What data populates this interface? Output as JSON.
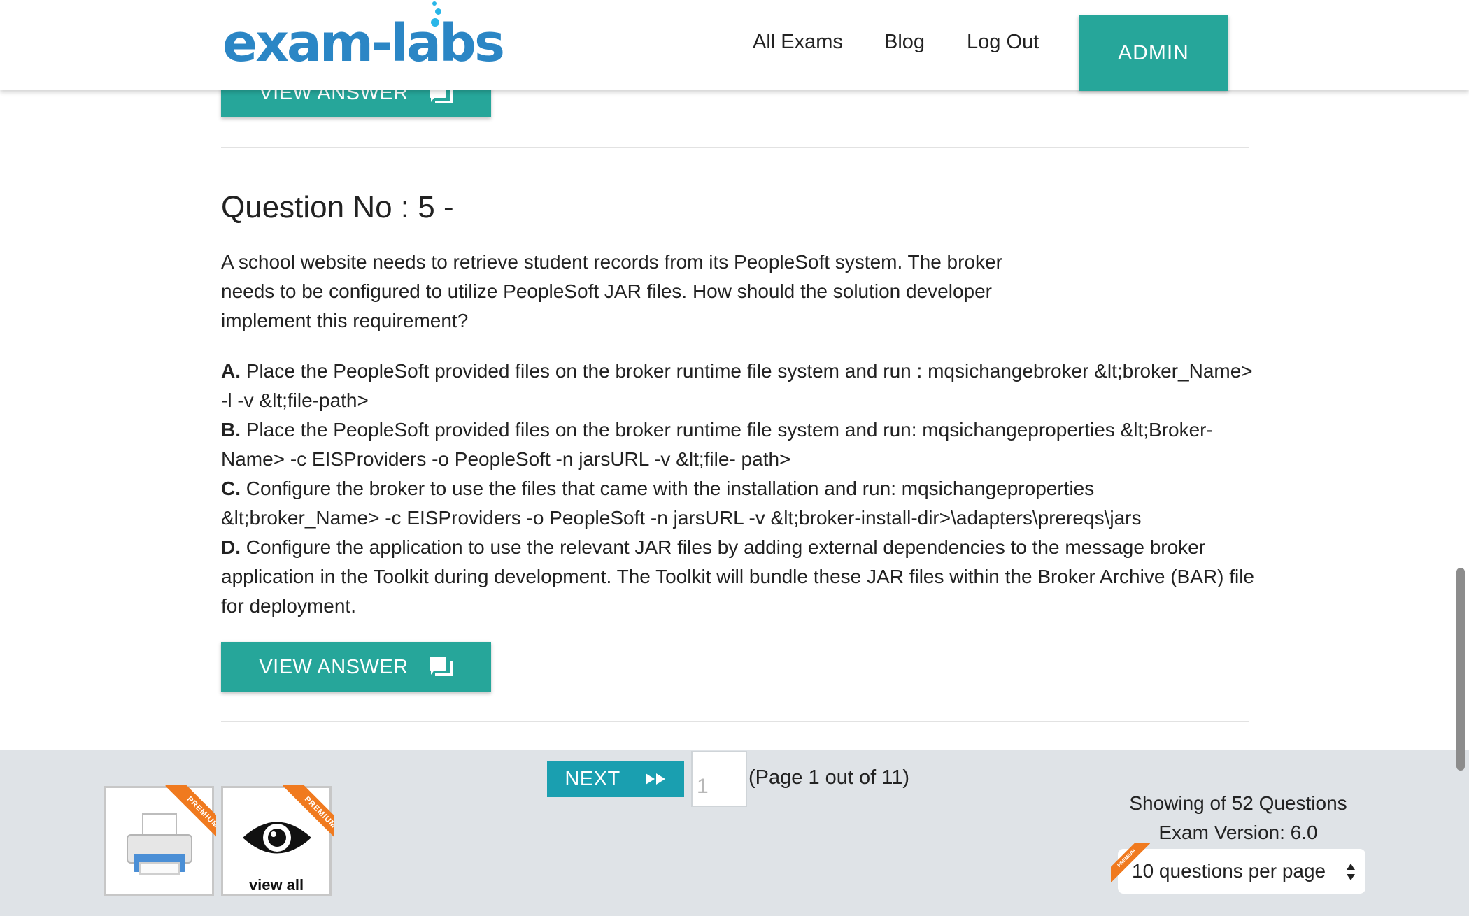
{
  "header": {
    "logo_text": "exam-labs",
    "nav": {
      "all_exams": "All Exams",
      "blog": "Blog",
      "log_out": "Log Out",
      "admin": "ADMIN"
    }
  },
  "question": {
    "prev_view_answer_label": "VIEW ANSWER",
    "title": "Question No : 5 -",
    "text": "A school website needs to retrieve student records from its PeopleSoft system. The broker needs to be configured to utilize PeopleSoft JAR files. How should the solution developer implement this requirement?",
    "options": [
      {
        "letter": "A.",
        "text": "Place the PeopleSoft provided files on the broker runtime file system and run : mqsichangebroker &lt;broker_Name> -l -v &lt;file-path>"
      },
      {
        "letter": "B.",
        "text": "Place the PeopleSoft provided files on the broker runtime file system and run: mqsichangeproperties &lt;Broker-Name> -c EISProviders -o PeopleSoft -n jarsURL -v &lt;file- path>"
      },
      {
        "letter": "C.",
        "text": "Configure the broker to use the files that came with the installation and run: mqsichangeproperties &lt;broker_Name> -c EISProviders -o PeopleSoft -n jarsURL -v &lt;broker-install-dir>\\adapters\\prereqs\\jars"
      },
      {
        "letter": "D.",
        "text": "Configure the application to use the relevant JAR files by adding external dependencies to the message broker application in the Toolkit during development. The Toolkit will bundle these JAR files within the Broker Archive (BAR) file for deployment."
      }
    ],
    "view_answer_label": "VIEW ANSWER"
  },
  "footer": {
    "premium_label": "PREMIUM",
    "view_all_label": "view all",
    "next_label": "NEXT",
    "page_input_value": "1",
    "page_info": "(Page 1 out of 11)",
    "showing": "Showing of 52 Questions",
    "exam_version": "Exam Version: 6.0",
    "per_page_selected": "10 questions per page"
  },
  "colors": {
    "teal": "#26a69a",
    "next_blue": "#1a9fb0",
    "logo_blue": "#2b86c5",
    "ribbon_orange": "#f07a1f",
    "footer_bg": "#dfe3e7"
  },
  "icons": [
    "chat-icon",
    "fast-forward-icon",
    "printer-icon",
    "eye-icon",
    "select-arrows-icon"
  ]
}
